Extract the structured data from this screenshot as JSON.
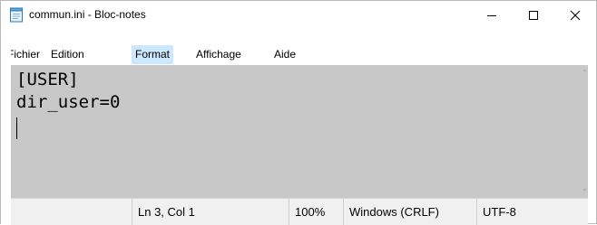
{
  "window": {
    "title": "commun.ini - Bloc-notes",
    "icon": "notepad-icon",
    "controls": {
      "minimize": "–",
      "maximize": "☐",
      "close": "✕"
    }
  },
  "menu": {
    "items": [
      {
        "label": "Fichier"
      },
      {
        "label": "Edition"
      },
      {
        "label": "Format"
      },
      {
        "label": "Affichage"
      },
      {
        "label": "Aide"
      }
    ],
    "highlighted": "Format"
  },
  "editor": {
    "lines": [
      "[USER]",
      "dir_user=0",
      ""
    ],
    "background": "#c8c8c8"
  },
  "status": {
    "position": "Ln 3, Col 1",
    "zoom": "100%",
    "line_ending": "Windows (CRLF)",
    "encoding": "UTF-8"
  },
  "colors": {
    "menu_highlight": "#cce8ff",
    "editor_bg": "#c8c8c8",
    "statusbar_bg": "#f0f0f0"
  }
}
